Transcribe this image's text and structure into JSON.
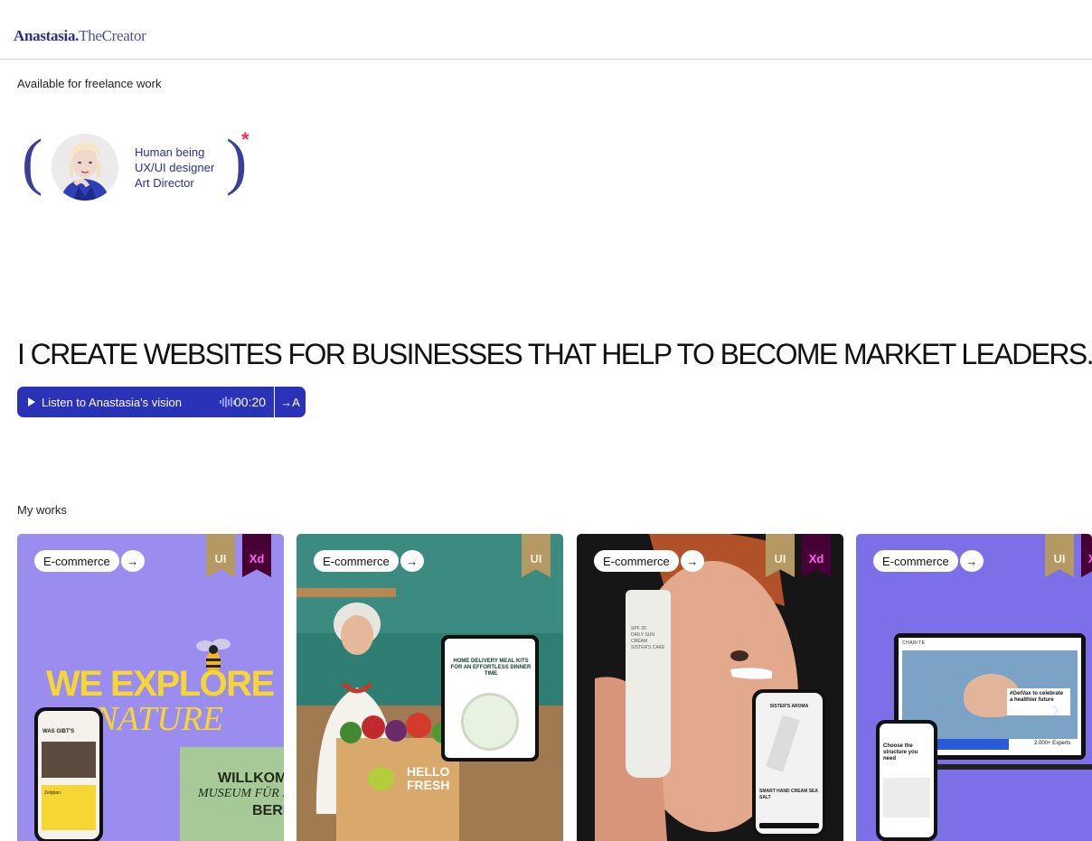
{
  "header": {
    "logo_bold": "Anastasia.",
    "logo_light": "TheCreator"
  },
  "availability": "Available for freelance work",
  "profile": {
    "roles": [
      "Human being",
      "UX/UI designer",
      "Art Director"
    ],
    "asterisk": "*"
  },
  "headline": "I CREATE WEBSITES FOR BUSINESSES THAT HELP TO BECOME MARKET LEADERS.",
  "audio": {
    "label": "Listen to Anastasia's vision",
    "time": "00:20",
    "lang": "A"
  },
  "works": {
    "label": "My works",
    "cards": [
      {
        "category": "E-commerce",
        "badges": [
          "UI",
          "Xd"
        ],
        "headline_line1": "WE EXPLORE",
        "headline_line2": "NATURE",
        "phone_text": "WAS GIBT'S",
        "phone_button": "Zeitplan",
        "panel_title": "WILLKOM",
        "panel_sub": "MUSEUM FÜR N",
        "panel_city": "BERL"
      },
      {
        "category": "E-commerce",
        "badges": [
          "UI"
        ],
        "box_text": "HELLO FRESH",
        "tablet_title": "HOME DELIVERY MEAL KITS FOR AN EFFORTLESS DINNER TIME"
      },
      {
        "category": "E-commerce",
        "badges": [
          "UI",
          "Xd"
        ],
        "tube_text": "SPF 30\nDAILY SUN CREAM\nSISTER'S CAKE",
        "phone_title": "SISTER'S AROMA",
        "phone_product": "SMART HAND CREAM SEA SALT"
      },
      {
        "category": "E-commerce",
        "badges": [
          "UI",
          "Xd"
        ],
        "site_logo": "CHARITE",
        "hero_text": "#GetVax to celebrate a healthier future",
        "stat": "2.000+ Experts",
        "phone_text": "Choose the structure you need"
      }
    ]
  },
  "colors": {
    "accent": "#2a32b8",
    "brand_text": "#2b2f8f",
    "asterisk": "#e4374f"
  }
}
